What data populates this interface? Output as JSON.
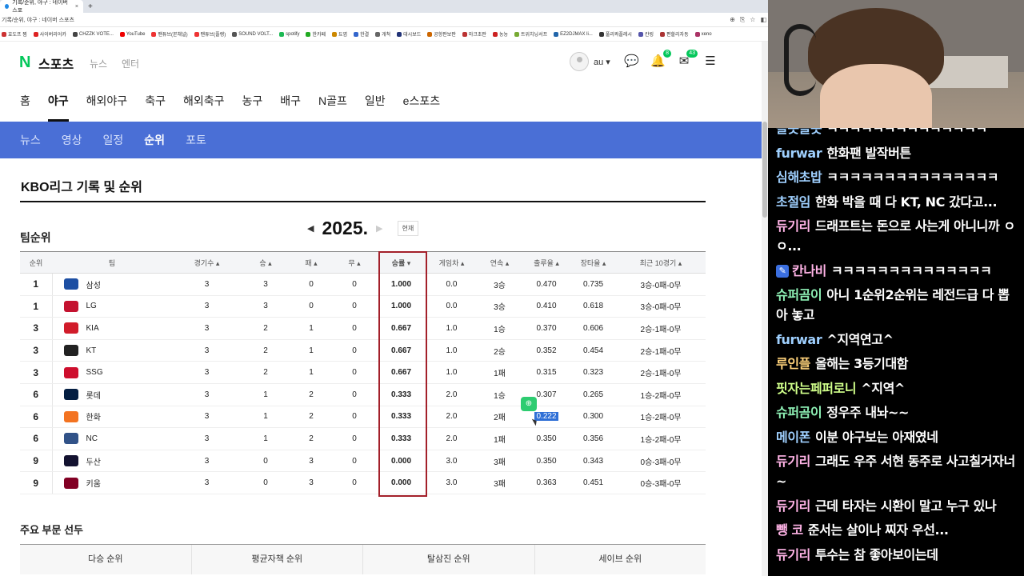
{
  "browser": {
    "tab_title": "기록/순위, 야구 : 네이버 스포",
    "tab_close": "×",
    "new_tab": "+",
    "address": "기록/순위, 야구 : 네이버 스포츠",
    "bookmarks": [
      "효도프 찜",
      "사이버리어카",
      "CHZZK VOTE...",
      "YouTube",
      "팬튜브(본채널)",
      "팬튜브(플랭)",
      "SOUND VOLT...",
      "spotify",
      "한카페",
      "됴엽",
      "한결",
      "개척",
      "대시보드",
      "공항판보판",
      "마크초판",
      "농농",
      "트위치닝서프",
      "EZ2DJMAX li...",
      "풀리콰플레시",
      "칸링",
      "편할리자동",
      "xeno"
    ]
  },
  "header": {
    "logo_n": "N",
    "logo_text": "스포츠",
    "link_news": "뉴스",
    "link_enter": "엔터",
    "user_name": "au ▾",
    "notif_count": "8",
    "mail_count": "43"
  },
  "main_nav": [
    "홈",
    "야구",
    "해외야구",
    "축구",
    "해외축구",
    "농구",
    "배구",
    "N골프",
    "일반",
    "e스포츠"
  ],
  "main_nav_active": "야구",
  "sub_nav": [
    "뉴스",
    "영상",
    "일정",
    "순위",
    "포토"
  ],
  "sub_nav_active": "순위",
  "page": {
    "title": "KBO리그 기록 및 순위",
    "section": "팀순위",
    "year": "2025.",
    "now_button": "현재",
    "leaders_title": "주요 부문 선두",
    "leader_tabs": [
      "다승 순위",
      "평균자책 순위",
      "탈삼진 순위",
      "세이브 순위"
    ]
  },
  "table": {
    "headers": [
      "순위",
      "팀",
      "경기수 ▴",
      "승 ▴",
      "패 ▴",
      "무 ▴",
      "승률 ▾",
      "게임차 ▴",
      "연속 ▴",
      "출루율 ▴",
      "장타율 ▴",
      "최근 10경기 ▴"
    ],
    "rows": [
      {
        "rank": "1",
        "team": "삼성",
        "g": "3",
        "w": "3",
        "l": "0",
        "d": "0",
        "pct": "1.000",
        "gb": "0.0",
        "streak": "3승",
        "obp": "0.470",
        "slg": "0.735",
        "last10": "3승-0패-0무",
        "color": "#1d4fa3"
      },
      {
        "rank": "1",
        "team": "LG",
        "g": "3",
        "w": "3",
        "l": "0",
        "d": "0",
        "pct": "1.000",
        "gb": "0.0",
        "streak": "3승",
        "obp": "0.410",
        "slg": "0.618",
        "last10": "3승-0패-0무",
        "color": "#c4122f"
      },
      {
        "rank": "3",
        "team": "KIA",
        "g": "3",
        "w": "2",
        "l": "1",
        "d": "0",
        "pct": "0.667",
        "gb": "1.0",
        "streak": "1승",
        "obp": "0.370",
        "slg": "0.606",
        "last10": "2승-1패-0무",
        "color": "#d11c2a"
      },
      {
        "rank": "3",
        "team": "KT",
        "g": "3",
        "w": "2",
        "l": "1",
        "d": "0",
        "pct": "0.667",
        "gb": "1.0",
        "streak": "2승",
        "obp": "0.352",
        "slg": "0.454",
        "last10": "2승-1패-0무",
        "color": "#222222"
      },
      {
        "rank": "3",
        "team": "SSG",
        "g": "3",
        "w": "2",
        "l": "1",
        "d": "0",
        "pct": "0.667",
        "gb": "1.0",
        "streak": "1패",
        "obp": "0.315",
        "slg": "0.323",
        "last10": "2승-1패-0무",
        "color": "#ce0e2d"
      },
      {
        "rank": "6",
        "team": "롯데",
        "g": "3",
        "w": "1",
        "l": "2",
        "d": "0",
        "pct": "0.333",
        "gb": "2.0",
        "streak": "1승",
        "obp": "0.307",
        "slg": "0.265",
        "last10": "1승-2패-0무",
        "color": "#041e42"
      },
      {
        "rank": "6",
        "team": "한화",
        "g": "3",
        "w": "1",
        "l": "2",
        "d": "0",
        "pct": "0.333",
        "gb": "2.0",
        "streak": "2패",
        "obp": "0.222",
        "slg": "0.300",
        "last10": "1승-2패-0무",
        "color": "#f37321"
      },
      {
        "rank": "6",
        "team": "NC",
        "g": "3",
        "w": "1",
        "l": "2",
        "d": "0",
        "pct": "0.333",
        "gb": "2.0",
        "streak": "1패",
        "obp": "0.350",
        "slg": "0.356",
        "last10": "1승-2패-0무",
        "color": "#315288"
      },
      {
        "rank": "9",
        "team": "두산",
        "g": "3",
        "w": "0",
        "l": "3",
        "d": "0",
        "pct": "0.000",
        "gb": "3.0",
        "streak": "3패",
        "obp": "0.350",
        "slg": "0.343",
        "last10": "0승-3패-0무",
        "color": "#131230"
      },
      {
        "rank": "9",
        "team": "키움",
        "g": "3",
        "w": "0",
        "l": "3",
        "d": "0",
        "pct": "0.000",
        "gb": "3.0",
        "streak": "3패",
        "obp": "0.363",
        "slg": "0.451",
        "last10": "0승-3패-0무",
        "color": "#820024"
      }
    ]
  },
  "chat": [
    {
      "nick": "슬픗슬픗",
      "text": "ㅋㅋㅋㅋㅋㅋㅋㅋㅋㅋㅋㅋㅋㅋ",
      "color": "#9fd0ff"
    },
    {
      "nick": "furwar",
      "text": "한화팬 발작버튼",
      "color": "#9fd0ff"
    },
    {
      "nick": "심해초밥",
      "text": "ㅋㅋㅋㅋㅋㅋㅋㅋㅋㅋㅋㅋㅋㅋㅋ",
      "color": "#9fd0ff"
    },
    {
      "nick": "초절임",
      "text": "한화 박을 때 다 KT, NC 갔다고...",
      "color": "#9fd0ff"
    },
    {
      "nick": "듀기리",
      "text": "드래프트는 돈으로 사는게 아니니까 ㅇㅇ...",
      "color": "#ffb3e6"
    },
    {
      "nick": "칸나비",
      "text": "ㅋㅋㅋㅋㅋㅋㅋㅋㅋㅋㅋㅋㅋㅋ",
      "color": "#ffb3e6",
      "pencil": true
    },
    {
      "nick": "슈퍼곰이",
      "text": "아니 1순위2순위는 레전드급 다 뽑아 놓고",
      "color": "#8ef0b5"
    },
    {
      "nick": "furwar",
      "text": "^지역연고^",
      "color": "#9fd0ff"
    },
    {
      "nick": "루인플",
      "text": "올해는 3등기대함",
      "color": "#ffd27a"
    },
    {
      "nick": "핏자는페퍼로니",
      "text": "^지역^",
      "color": "#d0ff8a"
    },
    {
      "nick": "슈퍼곰이",
      "text": "정우주 내놔~~",
      "color": "#8ef0b5"
    },
    {
      "nick": "메이폰",
      "text": "이분 야구보는 아재였네",
      "color": "#9fd0ff"
    },
    {
      "nick": "듀기리",
      "text": "그래도 우주 서현 동주로 사고칠거자너~",
      "color": "#ffb3e6"
    },
    {
      "nick": "듀기리",
      "text": "근데 타자는 시환이 말고 누구 있나",
      "color": "#ffb3e6"
    },
    {
      "nick": "뺑 코",
      "text": "준서는 살이나 찌자 우선...",
      "color": "#ffb3e6"
    },
    {
      "nick": "듀기리",
      "text": "투수는 참 좋아보이는데",
      "color": "#ffb3e6"
    }
  ]
}
